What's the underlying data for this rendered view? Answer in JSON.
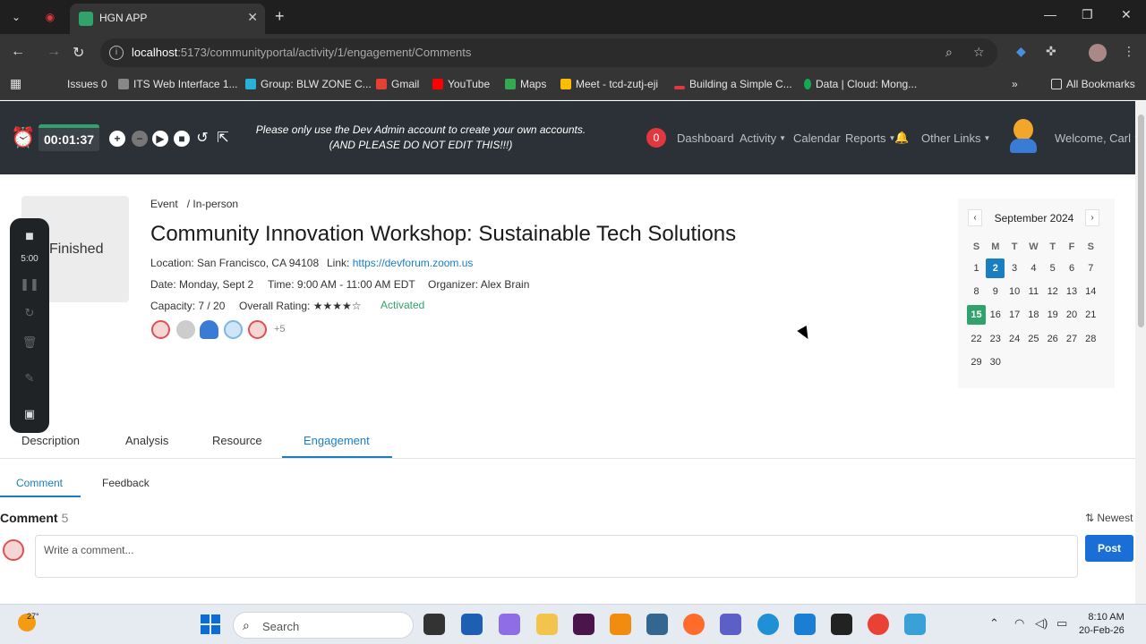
{
  "browser": {
    "tab_title": "HGN APP",
    "url_host": "localhost",
    "url_path": ":5173/communityportal/activity/1/engagement/Comments",
    "bookmarks": [
      "Issues 0",
      "ITS Web Interface 1...",
      "Group: BLW ZONE C...",
      "Gmail",
      "YouTube",
      "Maps",
      "Meet - tcd-zutj-eji",
      "Building a Simple C...",
      "Data | Cloud: Mong..."
    ],
    "all_bookmarks": "All Bookmarks"
  },
  "header": {
    "timer": "00:01:37",
    "notice": "Please only use the Dev Admin account to create your own accounts. (AND PLEASE DO NOT EDIT THIS!!!)",
    "notification_count": "0",
    "nav": [
      "Dashboard",
      "Activity",
      "Calendar",
      "Reports",
      "Other Links"
    ],
    "welcome": "Welcome, Carl"
  },
  "event": {
    "status": "Finished",
    "breadcrumb": "Event   / In-person",
    "title": "Community Innovation Workshop: Sustainable Tech Solutions",
    "location": "Location: San Francisco, CA 94108",
    "link_label": "Link:",
    "link": "https://devforum.zoom.us",
    "date": "Date: Monday, Sept 2",
    "time": "Time: 9:00 AM - 11:00 AM EDT",
    "organizer": "Organizer: Alex Brain",
    "capacity": "Capacity: 7 / 20",
    "rating_label": "Overall Rating:",
    "rating_stars": "★★★★☆",
    "state": "Activated",
    "more_attendees": "+5"
  },
  "recorder": {
    "time": "5:00"
  },
  "calendar": {
    "prev": "‹",
    "next": "›",
    "month": "September 2024",
    "dow": [
      "S",
      "M",
      "T",
      "W",
      "T",
      "F",
      "S"
    ],
    "days": [
      "1",
      "2",
      "3",
      "4",
      "5",
      "6",
      "7",
      "8",
      "9",
      "10",
      "11",
      "12",
      "13",
      "14",
      "15",
      "16",
      "17",
      "18",
      "19",
      "20",
      "21",
      "22",
      "23",
      "24",
      "25",
      "26",
      "27",
      "28",
      "29",
      "30"
    ],
    "selected": "2",
    "today": "15"
  },
  "tabs": [
    "Description",
    "Analysis",
    "Resource",
    "Engagement"
  ],
  "subtabs": [
    "Comment",
    "Feedback"
  ],
  "comments": {
    "heading": "Comment",
    "count": "5",
    "sort": "⇅ Newest",
    "placeholder": "Write a comment...",
    "post": "Post"
  },
  "taskbar": {
    "weather": "27°",
    "search": "Search",
    "time": "8:10 AM",
    "date": "20-Feb-26"
  },
  "colors": {
    "accent": "#1a7fc1",
    "header_bg": "#2b3136",
    "success": "#2fa36b",
    "danger": "#e0383e"
  }
}
